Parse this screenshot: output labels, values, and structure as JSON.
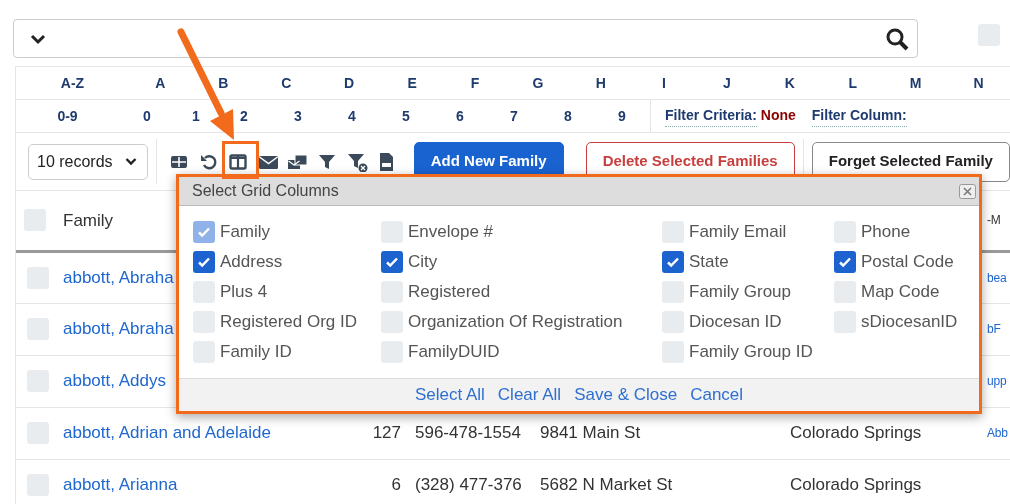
{
  "top_checkbox": {
    "checked": false
  },
  "letters": [
    "A-Z",
    "A",
    "B",
    "C",
    "D",
    "E",
    "F",
    "G",
    "H",
    "I",
    "J",
    "K",
    "L",
    "M",
    "N"
  ],
  "digits": [
    "0-9",
    "0",
    "1",
    "2",
    "3",
    "4",
    "5",
    "6",
    "7",
    "8",
    "9"
  ],
  "filter_criteria": {
    "label": "Filter Criteria:",
    "value": "None"
  },
  "filter_column": {
    "label": "Filter Column:"
  },
  "records_select": {
    "value": "10 records"
  },
  "buttons": [
    {
      "label": "Add New Family",
      "kind": "primary"
    },
    {
      "label": "Delete Selected Families",
      "kind": "danger"
    },
    {
      "label": "Forget Selected Family",
      "kind": "secondary"
    }
  ],
  "table": {
    "header": {
      "checked": false,
      "family": "Family",
      "column_6": "-M"
    },
    "rows": [
      {
        "checked": false,
        "family": "abbott, Abraha",
        "column_6": "bea"
      },
      {
        "checked": false,
        "family": "abbott, Abraha",
        "column_6": "bF"
      },
      {
        "checked": false,
        "family": "abbott, Addys",
        "column_6": "upp"
      },
      {
        "checked": false,
        "family": "abbott, Adrian and Adelaide",
        "column_2": "127",
        "column_3": "596-478-1554",
        "column_4": "9841 Main St",
        "column_5": "Colorado Springs",
        "column_6": "Abb"
      },
      {
        "checked": false,
        "family": "abbott, Arianna",
        "column_2": "6",
        "column_3": "(328) 477-376",
        "column_4": "5682 N Market St",
        "column_5": "Colorado Springs"
      }
    ]
  },
  "dialog": {
    "title": "Select Grid Columns",
    "options": [
      {
        "label": "Family",
        "checked": true,
        "disabled": true
      },
      {
        "label": "Envelope #",
        "checked": false,
        "disabled": false
      },
      {
        "label": "Family Email",
        "checked": false,
        "disabled": false
      },
      {
        "label": "Phone",
        "checked": false,
        "disabled": false
      },
      {
        "label": "Address",
        "checked": true,
        "disabled": false
      },
      {
        "label": "City",
        "checked": true,
        "disabled": false
      },
      {
        "label": "State",
        "checked": true,
        "disabled": false
      },
      {
        "label": "Postal Code",
        "checked": true,
        "disabled": false
      },
      {
        "label": "Plus 4",
        "checked": false,
        "disabled": false
      },
      {
        "label": "Registered",
        "checked": false,
        "disabled": false
      },
      {
        "label": "Family Group",
        "checked": false,
        "disabled": false
      },
      {
        "label": "Map Code",
        "checked": false,
        "disabled": false
      },
      {
        "label": "Registered Org ID",
        "checked": false,
        "disabled": false
      },
      {
        "label": "Organization Of Registration",
        "checked": false,
        "disabled": false
      },
      {
        "label": "Diocesan ID",
        "checked": false,
        "disabled": false
      },
      {
        "label": "sDiocesanID",
        "checked": false,
        "disabled": false
      },
      {
        "label": "Family ID",
        "checked": false,
        "disabled": false
      },
      {
        "label": "FamilyDUID",
        "checked": false,
        "disabled": false
      },
      {
        "label": "Family Group ID",
        "checked": false,
        "disabled": false
      }
    ],
    "actions": [
      "Select All",
      "Clear All",
      "Save & Close",
      "Cancel"
    ]
  }
}
